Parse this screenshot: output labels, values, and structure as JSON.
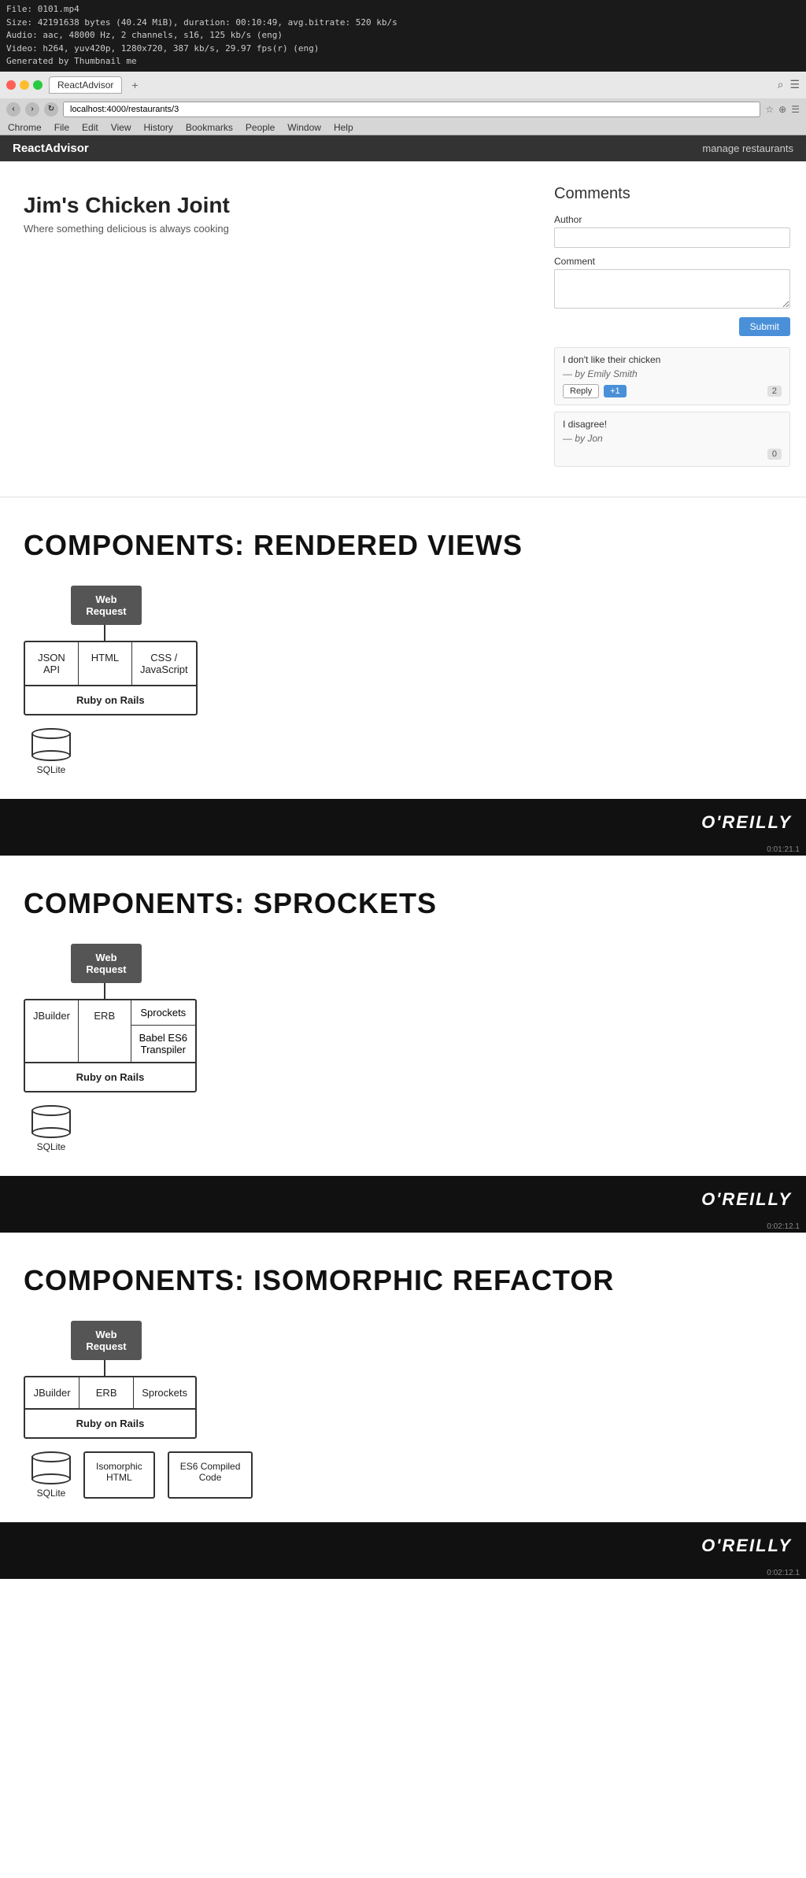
{
  "video_info": {
    "filename": "File: 0101.mp4",
    "size": "Size: 42191638 bytes (40.24 MiB), duration: 00:10:49, avg.bitrate: 520 kb/s",
    "audio": "Audio: aac, 48000 Hz, 2 channels, s16, 125 kb/s (eng)",
    "video": "Video: h264, yuv420p, 1280x720, 387 kb/s, 29.97 fps(r) (eng)",
    "generated": "Generated by Thumbnail me"
  },
  "browser": {
    "menu_items": [
      "Chrome",
      "File",
      "Edit",
      "View",
      "History",
      "Bookmarks",
      "People",
      "Window",
      "Help"
    ],
    "tab_label": "ReactAdvisor",
    "address": "localhost:4000/restaurants/3",
    "nav_back": "←",
    "nav_forward": "→"
  },
  "app": {
    "brand": "ReactAdvisor",
    "manage_link": "manage restaurants"
  },
  "restaurant": {
    "title": "Jim's Chicken Joint",
    "subtitle": "Where something delicious is always cooking",
    "comments_title": "Comments",
    "author_label": "Author",
    "comment_label": "Comment",
    "author_placeholder": "",
    "comment_placeholder": "",
    "submit_label": "Submit",
    "comments": [
      {
        "text": "I don't like their chicken",
        "author": "— by Emily Smith",
        "vote_count": "2",
        "reply_label": "Reply",
        "plus_label": "+1"
      },
      {
        "text": "I disagree!",
        "author": "— by Jon",
        "vote_count": "0"
      }
    ]
  },
  "slide1": {
    "title": "COMPONENTS: RENDERED VIEWS",
    "web_request_label": "Web\nRequest",
    "box_cells": [
      "JSON API",
      "HTML",
      "CSS /\nJavaScript"
    ],
    "box_bottom": "Ruby on Rails",
    "sqlite_label": "SQLite",
    "oreilly_label": "O'REILLY",
    "timestamp": "0:01:21.1"
  },
  "slide2": {
    "title": "COMPONENTS: SPROCKETS",
    "web_request_label": "Web\nRequest",
    "box_cells_left": [
      "JBuilder",
      "ERB"
    ],
    "box_cells_right_top": "Sprockets",
    "box_cells_right_bottom": "Babel ES6\nTranspiler",
    "box_bottom": "Ruby on Rails",
    "sqlite_label": "SQLite",
    "oreilly_label": "O'REILLY",
    "timestamp": "0:02:12.1"
  },
  "slide3": {
    "title": "COMPONENTS: ISOMORPHIC REFACTOR",
    "web_request_label": "Web\nRequest",
    "box_cells": [
      "JBuilder",
      "ERB",
      "Sprockets"
    ],
    "box_bottom": "Ruby on Rails",
    "sqlite_label": "SQLite",
    "extra_boxes": [
      "Isomorphic\nHTML",
      "ES6 Compiled\nCode"
    ],
    "oreilly_label": "O'REILLY",
    "timestamp": "0:02:12.1"
  }
}
